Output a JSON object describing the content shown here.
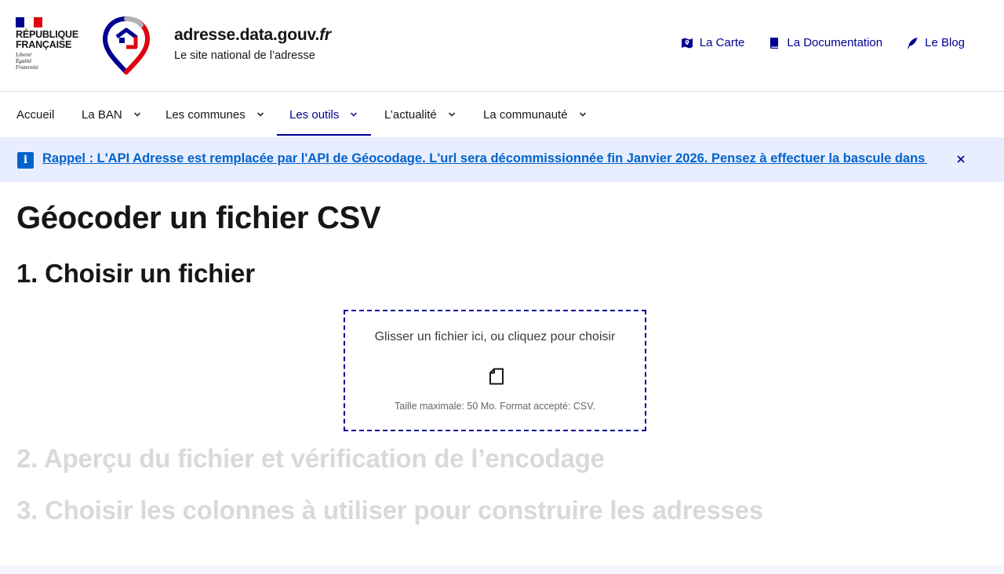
{
  "header": {
    "republique": "République\nFrançaise",
    "motto": "Liberté\nÉgalité\nFraternité",
    "site_title_main": "adresse.data.gouv.",
    "site_title_ext": "fr",
    "tagline": "Le site national de l’adresse",
    "quick_links": [
      {
        "label": "La Carte",
        "icon": "map-icon"
      },
      {
        "label": "La Documentation",
        "icon": "book-icon"
      },
      {
        "label": "Le Blog",
        "icon": "quill-icon"
      }
    ]
  },
  "nav": {
    "items": [
      {
        "label": "Accueil",
        "has_dropdown": false
      },
      {
        "label": "La BAN",
        "has_dropdown": true
      },
      {
        "label": "Les communes",
        "has_dropdown": true
      },
      {
        "label": "Les outils",
        "has_dropdown": true,
        "active": true
      },
      {
        "label": "L’actualité",
        "has_dropdown": true
      },
      {
        "label": "La communauté",
        "has_dropdown": true
      }
    ]
  },
  "notice": {
    "text": "Rappel : L'API Adresse est remplacée par l'API de Géocodage. L'url sera décommissionnée fin Janvier 2026. Pensez à effectuer la bascule dans vos outils."
  },
  "main": {
    "title": "Géocoder un fichier CSV",
    "steps": [
      {
        "label": "1. Choisir un fichier",
        "active": true
      },
      {
        "label": "2. Aperçu du fichier et vérification de l’encodage",
        "active": false
      },
      {
        "label": "3. Choisir les colonnes à utiliser pour construire les adresses",
        "active": false
      }
    ],
    "dropzone": {
      "text": "Glisser un fichier ici, ou cliquez pour choisir",
      "hint": "Taille maximale: 50 Mo. Format accepté: CSV.",
      "icon": "file-icon"
    }
  },
  "colors": {
    "primary": "#000091",
    "info": "#0063cb",
    "notice_bg": "#e8edff",
    "disabled_text": "#d9d9d9",
    "marianne_red": "#e1000f"
  }
}
